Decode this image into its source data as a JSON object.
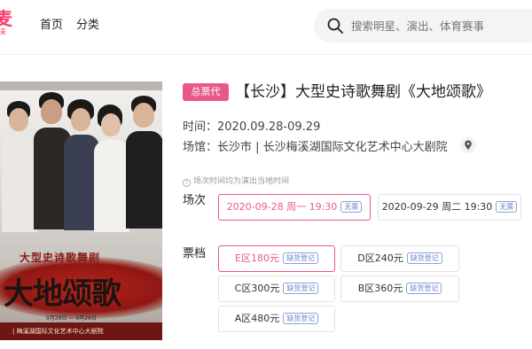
{
  "header": {
    "logo_text": "麦",
    "logo_sub": "麦",
    "nav": [
      "首页",
      "分类"
    ],
    "search_placeholder": "搜索明星、演出、体育赛事"
  },
  "poster": {
    "subtitle": "大型史诗歌舞剧",
    "main_title": "大地颂歌",
    "dates": "9月28日 — 9月29日",
    "venue": "| 梅溪湖国际文化艺术中心大剧院"
  },
  "show": {
    "tag": "总票代",
    "title": "【长沙】大型史诗歌舞剧《大地颂歌》",
    "time": "时间：2020.09.28-09.29",
    "venue": "场馆：长沙市 | 长沙梅溪湖国际文化艺术中心大剧院",
    "note": "场次时间均为演出当地时间"
  },
  "sessions": {
    "label": "场次",
    "items": [
      {
        "text": "2020-09-28 周一 19:30",
        "badge": "无票",
        "selected": true
      },
      {
        "text": "2020-09-29 周二 19:30",
        "badge": "无票",
        "selected": false
      }
    ]
  },
  "tickets": {
    "label": "票档",
    "items": [
      {
        "text": "E区180元",
        "badge": "缺货登记",
        "selected": true
      },
      {
        "text": "D区240元",
        "badge": "缺货登记",
        "selected": false
      },
      {
        "text": "C区300元",
        "badge": "缺货登记",
        "selected": false
      },
      {
        "text": "B区360元",
        "badge": "缺货登记",
        "selected": false
      },
      {
        "text": "A区480元",
        "badge": "缺货登记",
        "selected": false
      }
    ]
  },
  "colors": {
    "accent": "#e8588b",
    "brand": "#ff3a6e",
    "badge": "#6a82c8"
  }
}
